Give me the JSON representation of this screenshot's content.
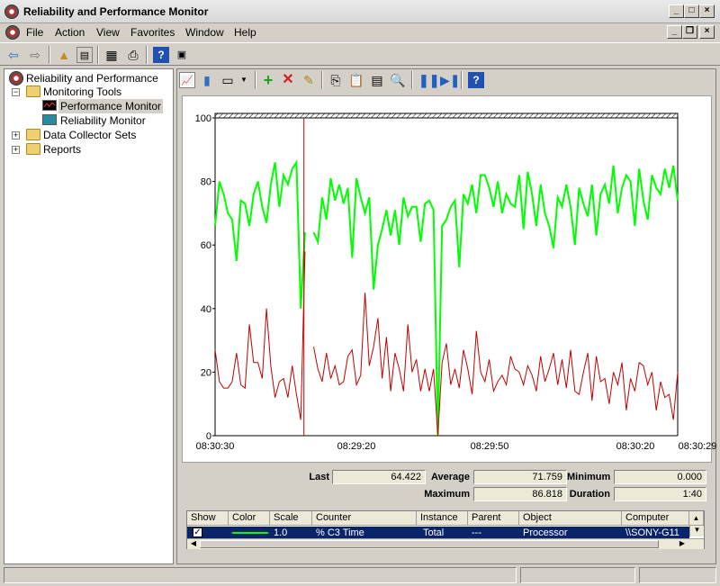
{
  "window": {
    "title": "Reliability and Performance Monitor"
  },
  "menu": [
    "File",
    "Action",
    "View",
    "Favorites",
    "Window",
    "Help"
  ],
  "tree": {
    "root": "Reliability and Performance",
    "monitoring_tools": "Monitoring Tools",
    "performance_monitor": "Performance Monitor",
    "reliability_monitor": "Reliability Monitor",
    "data_collector_sets": "Data Collector Sets",
    "reports": "Reports"
  },
  "chart_data": {
    "type": "line",
    "ylim": [
      0,
      100
    ],
    "yticks": [
      "100",
      "80",
      "60",
      "40",
      "20",
      "0"
    ],
    "xticks": [
      "08:30:30",
      "08:29:20",
      "08:29:50",
      "08:30:20",
      "08:30:29"
    ],
    "colors": {
      "green": "#00ff00",
      "red": "#c00000",
      "cursor": "#c00000"
    },
    "series": [
      {
        "color": "#00ff00",
        "values": [
          66,
          80,
          76,
          70,
          68,
          55,
          74,
          73,
          66,
          76,
          80,
          72,
          67,
          79,
          86,
          72,
          82,
          79,
          84,
          86,
          40,
          64,
          null,
          64,
          61,
          75,
          68,
          81,
          74,
          79,
          73,
          78,
          56,
          81,
          75,
          70,
          75,
          46,
          60,
          65,
          71,
          63,
          71,
          60,
          75,
          69,
          72,
          72,
          61,
          73,
          74,
          71,
          0,
          66,
          68,
          72,
          74,
          53,
          76,
          73,
          79,
          70,
          82,
          82,
          78,
          72,
          80,
          70,
          76,
          73,
          72,
          82,
          65,
          83,
          76,
          66,
          79,
          70,
          66,
          59,
          75,
          72,
          79,
          72,
          60,
          78,
          73,
          69,
          79,
          63,
          76,
          79,
          73,
          85,
          70,
          78,
          82,
          80,
          66,
          84,
          74,
          68,
          82,
          78,
          76,
          84,
          78,
          85,
          74
        ]
      },
      {
        "color": "#c00000",
        "values": [
          27,
          17,
          15,
          15,
          17,
          26,
          16,
          15,
          35,
          23,
          23,
          18,
          40,
          22,
          12,
          17,
          18,
          12,
          22,
          13,
          5,
          58,
          null,
          28,
          21,
          17,
          26,
          18,
          22,
          16,
          17,
          25,
          27,
          16,
          19,
          45,
          22,
          28,
          37,
          18,
          31,
          14,
          26,
          21,
          14,
          35,
          20,
          24,
          14,
          21,
          14,
          21,
          0,
          23,
          29,
          16,
          21,
          15,
          27,
          21,
          13,
          33,
          20,
          17,
          24,
          14,
          17,
          19,
          16,
          25,
          21,
          20,
          16,
          22,
          19,
          14,
          25,
          17,
          21,
          26,
          16,
          24,
          15,
          27,
          14,
          13,
          20,
          26,
          11,
          25,
          17,
          18,
          10,
          20,
          16,
          23,
          8,
          18,
          14,
          23,
          22,
          16,
          20,
          8,
          17,
          12,
          13,
          5,
          20
        ]
      }
    ]
  },
  "stats": {
    "last_label": "Last",
    "last_value": "64.422",
    "average_label": "Average",
    "average_value": "71.759",
    "minimum_label": "Minimum",
    "minimum_value": "0.000",
    "maximum_label": "Maximum",
    "maximum_value": "86.818",
    "duration_label": "Duration",
    "duration_value": "1:40"
  },
  "legend": {
    "columns": [
      "Show",
      "Color",
      "Scale",
      "Counter",
      "Instance",
      "Parent",
      "Object",
      "Computer"
    ],
    "row": {
      "scale": "1.0",
      "counter": "% C3 Time",
      "instance": "Total",
      "parent": "---",
      "object": "Processor",
      "computer": "\\\\SONY-G11"
    },
    "row_color": "#00ff00"
  }
}
